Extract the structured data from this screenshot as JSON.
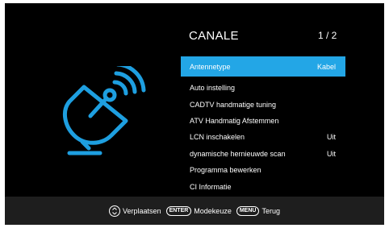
{
  "menu": {
    "title": "CANALE",
    "page": "1 / 2",
    "items": [
      {
        "label": "Antennetype",
        "value": "Kabel",
        "selected": true
      },
      {
        "label": "Auto instelling",
        "value": ""
      },
      {
        "label": "CADTV handmatige tuning",
        "value": ""
      },
      {
        "label": "ATV Handmatig Afstemmen",
        "value": ""
      },
      {
        "label": "LCN inschakelen",
        "value": "Uit"
      },
      {
        "label": "dynamische hernieuwde scan",
        "value": "Uit"
      },
      {
        "label": "Programma bewerken",
        "value": ""
      },
      {
        "label": "CI Informatie",
        "value": ""
      }
    ]
  },
  "footer": {
    "move_label": "Verplaatsen",
    "enter_key": "ENTER",
    "select_label": "Modekeuze",
    "menu_key": "MENU",
    "back_label": "Terug"
  },
  "icons": {
    "channel_icon": "satellite-dish-icon",
    "nav_icon": "up-down-arrow-icon"
  },
  "colors": {
    "background": "#000000",
    "highlight": "#23a6e6",
    "icon": "#1e9fe0",
    "footer": "#1e1e1e"
  }
}
